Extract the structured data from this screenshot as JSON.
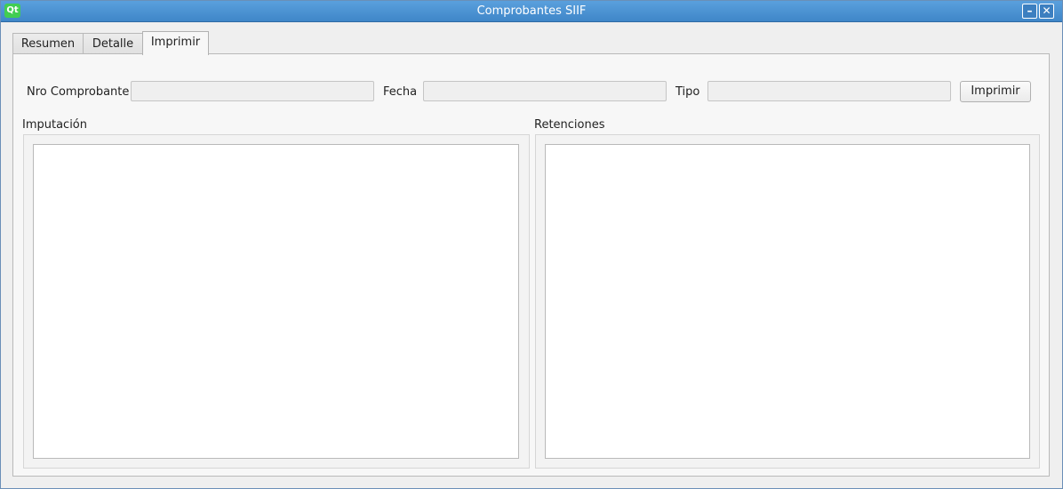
{
  "window": {
    "title": "Comprobantes SIIF",
    "logo_text": "Qt",
    "minimize_glyph": "–",
    "close_glyph": "✕"
  },
  "tabs": [
    {
      "label": "Resumen",
      "selected": false
    },
    {
      "label": "Detalle",
      "selected": false
    },
    {
      "label": "Imprimir",
      "selected": true
    }
  ],
  "form": {
    "nro_comprobante_label": "Nro Comprobante",
    "nro_comprobante_value": "",
    "fecha_label": "Fecha",
    "fecha_value": "",
    "tipo_label": "Tipo",
    "tipo_value": "",
    "print_button_label": "Imprimir"
  },
  "sections": {
    "imputacion_title": "Imputación",
    "retenciones_title": "Retenciones"
  },
  "colors": {
    "titlebar": "#3f86c8",
    "qt_green": "#41cd52"
  }
}
